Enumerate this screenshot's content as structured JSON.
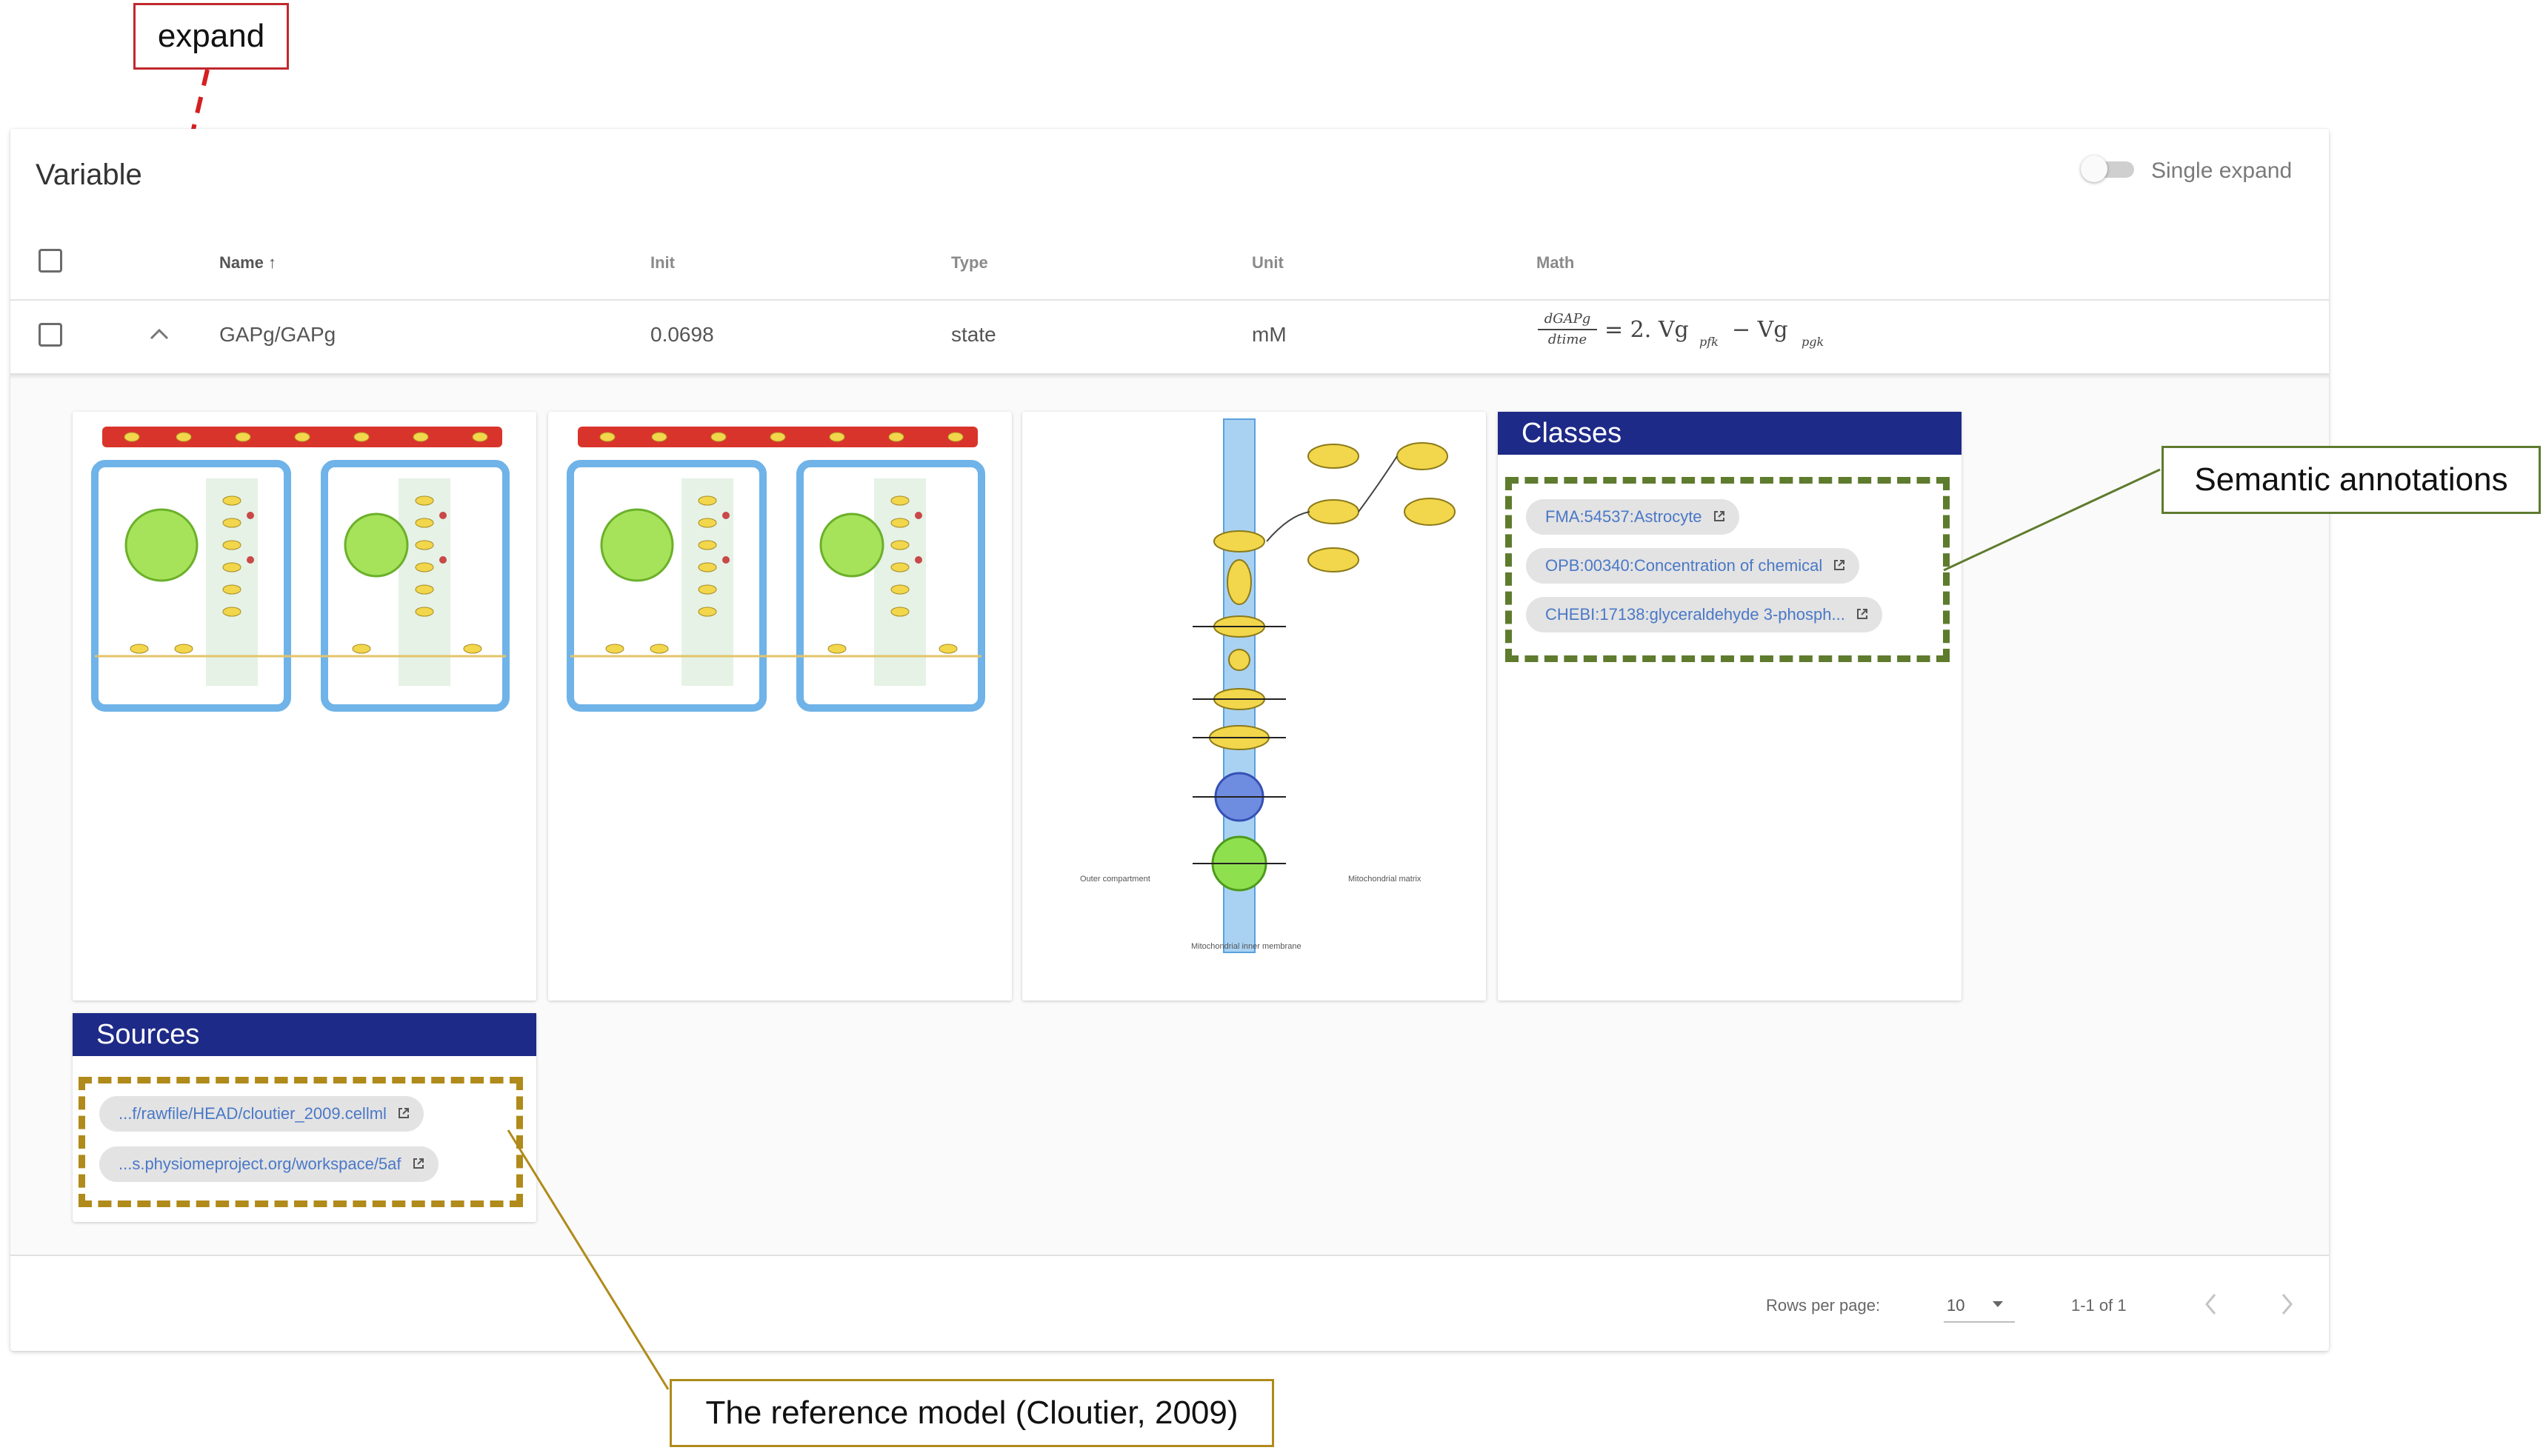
{
  "annotations": {
    "expand": "expand",
    "semantic": "Semantic annotations",
    "reference": "The reference model (Cloutier, 2009)"
  },
  "table": {
    "title": "Variable",
    "single_expand_label": "Single expand",
    "single_expand_on": false,
    "headers": {
      "name": "Name ↑",
      "init": "Init",
      "type": "Type",
      "unit": "Unit",
      "math": "Math"
    },
    "row": {
      "name": "GAPg/GAPg",
      "init": "0.0698",
      "type": "state",
      "unit": "mM",
      "math": {
        "numerator": "dGAPg",
        "denominator": "dtime",
        "rhs": "= 2. Vg",
        "sub1": "pfk",
        "minus": "− Vg",
        "sub2": "pgk"
      }
    }
  },
  "classes": {
    "title": "Classes",
    "items": [
      "FMA:54537:Astrocyte",
      "OPB:00340:Concentration of chemical",
      "CHEBI:17138:glyceraldehyde 3-phosph..."
    ]
  },
  "sources": {
    "title": "Sources",
    "items": [
      "...f/rawfile/HEAD/cloutier_2009.cellml",
      "...s.physiomeproject.org/workspace/5af"
    ]
  },
  "diagram_labels": {
    "outer": "Outer compartment",
    "matrix": "Mitochondrial matrix",
    "membrane": "Mitochondrial inner membrane"
  },
  "footer": {
    "rows_per_page_label": "Rows per page:",
    "rows_per_page_value": "10",
    "range": "1-1 of 1"
  },
  "colors": {
    "panel_header": "#1e2a87",
    "classes_box": "#5e7b2e",
    "sources_box": "#b08a1a",
    "expand_arrow": "#d42020",
    "expand_box": "#c0282d"
  }
}
